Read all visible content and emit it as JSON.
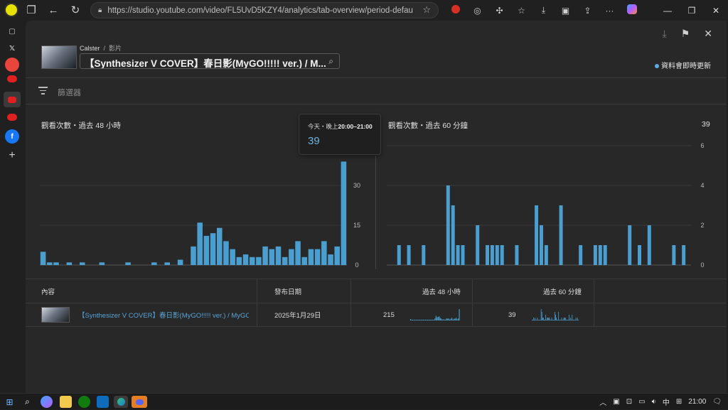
{
  "browser": {
    "url": "https://studio.youtube.com/video/FL5UvD5KZY4/analytics/tab-overview/period-default/explore..."
  },
  "header": {
    "channel": "Calster",
    "section": "影片",
    "video_title": "【Synthesizer V COVER】春日影(MyGO!!!!! ver.) / M...",
    "realtime_note": "資料會即時更新"
  },
  "filter": {
    "placeholder": "篩選器"
  },
  "tooltip": {
    "prefix": "今天・晚上",
    "time": "20:00–21:00",
    "value": "39"
  },
  "chart_data": [
    {
      "type": "bar",
      "title": "觀看次數・過去 48 小時",
      "xlabel": "",
      "ylabel": "",
      "ylim": [
        0,
        45
      ],
      "yticks": [
        0,
        15,
        30
      ],
      "color": "#4a9fd0",
      "highlight_color": "#3a6f8c",
      "highlight_index": 47,
      "values": [
        5,
        1,
        1,
        0,
        1,
        0,
        1,
        0,
        0,
        1,
        0,
        0,
        0,
        1,
        0,
        0,
        0,
        1,
        0,
        1,
        0,
        2,
        0,
        7,
        16,
        11,
        12,
        14,
        9,
        6,
        3,
        4,
        3,
        3,
        7,
        6,
        7,
        3,
        6,
        9,
        3,
        6,
        6,
        9,
        4,
        7,
        39
      ]
    },
    {
      "type": "bar",
      "title": "觀看次數・過去 60 分鐘",
      "total": "39",
      "xlabel": "",
      "ylabel": "",
      "ylim": [
        0,
        6
      ],
      "yticks": [
        0,
        2,
        4,
        6
      ],
      "color": "#4a9fd0",
      "values": [
        0,
        0,
        1,
        0,
        1,
        0,
        0,
        1,
        0,
        0,
        0,
        0,
        4,
        3,
        1,
        1,
        0,
        0,
        2,
        0,
        1,
        1,
        1,
        1,
        0,
        0,
        1,
        0,
        0,
        0,
        3,
        2,
        1,
        0,
        0,
        3,
        0,
        0,
        0,
        1,
        0,
        0,
        1,
        1,
        1,
        0,
        0,
        0,
        0,
        2,
        0,
        1,
        0,
        2,
        0,
        0,
        0,
        0,
        1,
        0,
        1,
        0
      ]
    }
  ],
  "table": {
    "headers": {
      "content": "內容",
      "published": "發布日期",
      "h48": "過去 48 小時",
      "m60": "過去 60 分鐘"
    },
    "row": {
      "title": "【Synthesizer V COVER】春日影(MyGO!!!!! ver.) / MyGO!!!!!...",
      "date": "2025年1月29日",
      "views48": "215",
      "views60": "39"
    }
  },
  "taskbar": {
    "ime": "中",
    "clock": "21:00"
  }
}
